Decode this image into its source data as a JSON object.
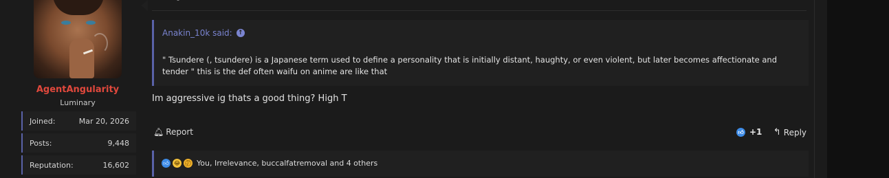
{
  "user": {
    "name": "AgentAngularity",
    "title": "Luminary",
    "stats": [
      {
        "label": "Joined:",
        "value": "Mar 20, 2026"
      },
      {
        "label": "Posts:",
        "value": "9,448"
      },
      {
        "label": "Reputation:",
        "value": "16,602"
      }
    ]
  },
  "quote": {
    "author": "Anakin_10k said:",
    "line1": "\" Tsundere (, tsundere) is a Japanese term used to define a personality that is initially distant, haughty, or even violent, but later becomes affectionate and",
    "line2": "tender \" this is the def often waifu on anime are like that"
  },
  "message": {
    "text": "Im aggressive ig thats a good thing? High T"
  },
  "actions": {
    "report_label": "Report",
    "reaction_score": "+1",
    "reply_label": "Reply"
  },
  "reactions": {
    "icons": [
      "like-icon",
      "laugh-icon",
      "thinking-icon"
    ],
    "summary": "You, Irrelevance, buccalfatremoval and 4 others"
  },
  "colors": {
    "accent": "#5a62a8",
    "username": "#e0483c",
    "link": "#7a84d0",
    "like": "#3d8be6"
  }
}
